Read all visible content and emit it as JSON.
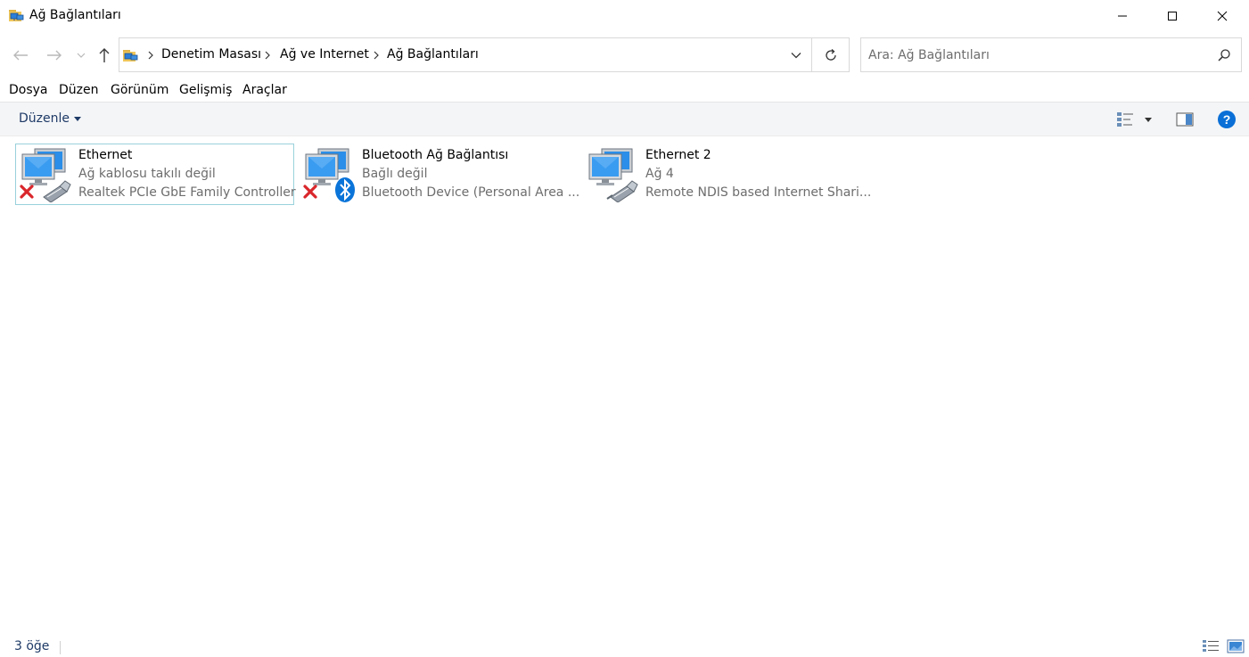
{
  "window": {
    "title": "Ağ Bağlantıları"
  },
  "address": {
    "crumbs": [
      "Denetim Masası",
      "Ağ ve Internet",
      "Ağ Bağlantıları"
    ]
  },
  "search": {
    "placeholder": "Ara: Ağ Bağlantıları"
  },
  "menu": [
    "Dosya",
    "Düzen",
    "Görünüm",
    "Gelişmiş",
    "Araçlar"
  ],
  "command": {
    "organize_label": "Düzenle"
  },
  "items": [
    {
      "name": "Ethernet",
      "status": "Ağ kablosu takılı değil",
      "device": "Realtek PCIe GbE Family Controller",
      "icon": "ethernet-disconnected-icon",
      "selected": true
    },
    {
      "name": "Bluetooth Ağ Bağlantısı",
      "status": "Bağlı değil",
      "device": "Bluetooth Device (Personal Area ...",
      "icon": "bluetooth-disconnected-icon",
      "selected": false
    },
    {
      "name": "Ethernet 2",
      "status": "Ağ 4",
      "device": "Remote NDIS based Internet Shari...",
      "icon": "ethernet-connected-icon",
      "selected": false
    }
  ],
  "statusbar": {
    "count": "3 öğe"
  },
  "colors": {
    "accent": "#1e3a66",
    "selection_border": "#99d1dc",
    "error_red": "#d9262b",
    "bluetooth_blue": "#0a74d9",
    "help_blue": "#0a6fd6"
  }
}
